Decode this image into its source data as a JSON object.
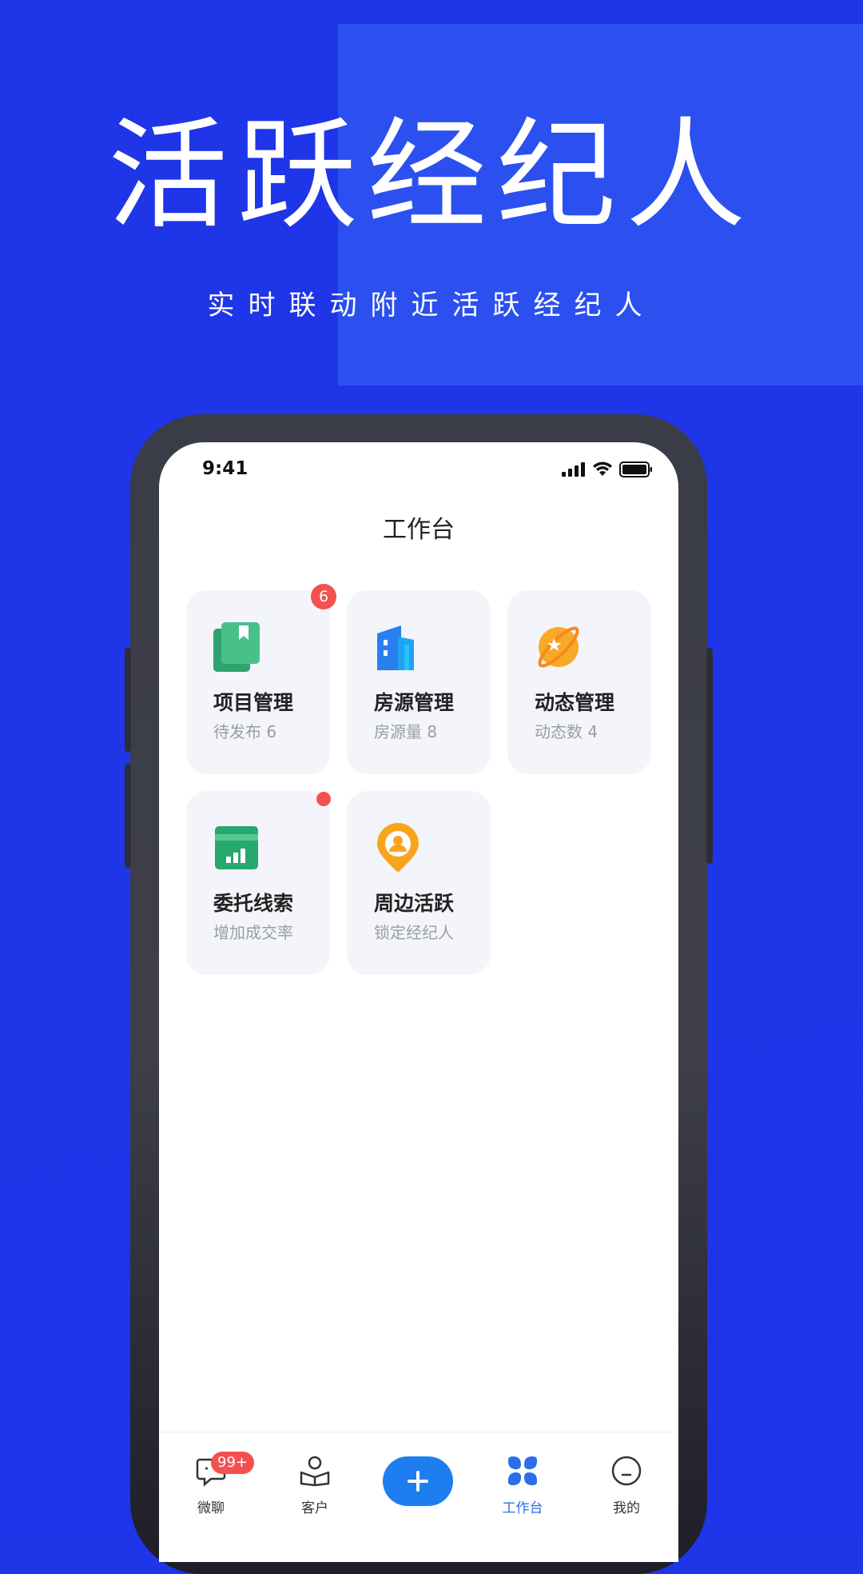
{
  "promo": {
    "headline": "活跃经纪人",
    "subline": "实时联动附近活跃经纪人"
  },
  "status_bar": {
    "time": "9:41"
  },
  "page": {
    "title": "工作台"
  },
  "cards": [
    {
      "title": "项目管理",
      "sub": "待发布 6",
      "badge": "6",
      "icon": "book-icon"
    },
    {
      "title": "房源管理",
      "sub": "房源量 8",
      "icon": "building-icon"
    },
    {
      "title": "动态管理",
      "sub": "动态数 4",
      "icon": "planet-icon"
    },
    {
      "title": "委托线索",
      "sub": "增加成交率",
      "badge_dot": true,
      "icon": "chart-card-icon"
    },
    {
      "title": "周边活跃",
      "sub": "锁定经纪人",
      "icon": "location-person-icon"
    }
  ],
  "tabs": [
    {
      "label": "微聊",
      "badge": "99+",
      "icon": "chat-icon"
    },
    {
      "label": "客户",
      "icon": "customer-icon"
    },
    {
      "label": "",
      "icon": "plus-icon"
    },
    {
      "label": "工作台",
      "active": true,
      "icon": "workbench-icon"
    },
    {
      "label": "我的",
      "icon": "profile-icon"
    }
  ],
  "colors": {
    "background": "#1f35e8",
    "accent": "#1e7ef0",
    "badge": "#f4504f",
    "card_bg": "#f3f5fa"
  }
}
